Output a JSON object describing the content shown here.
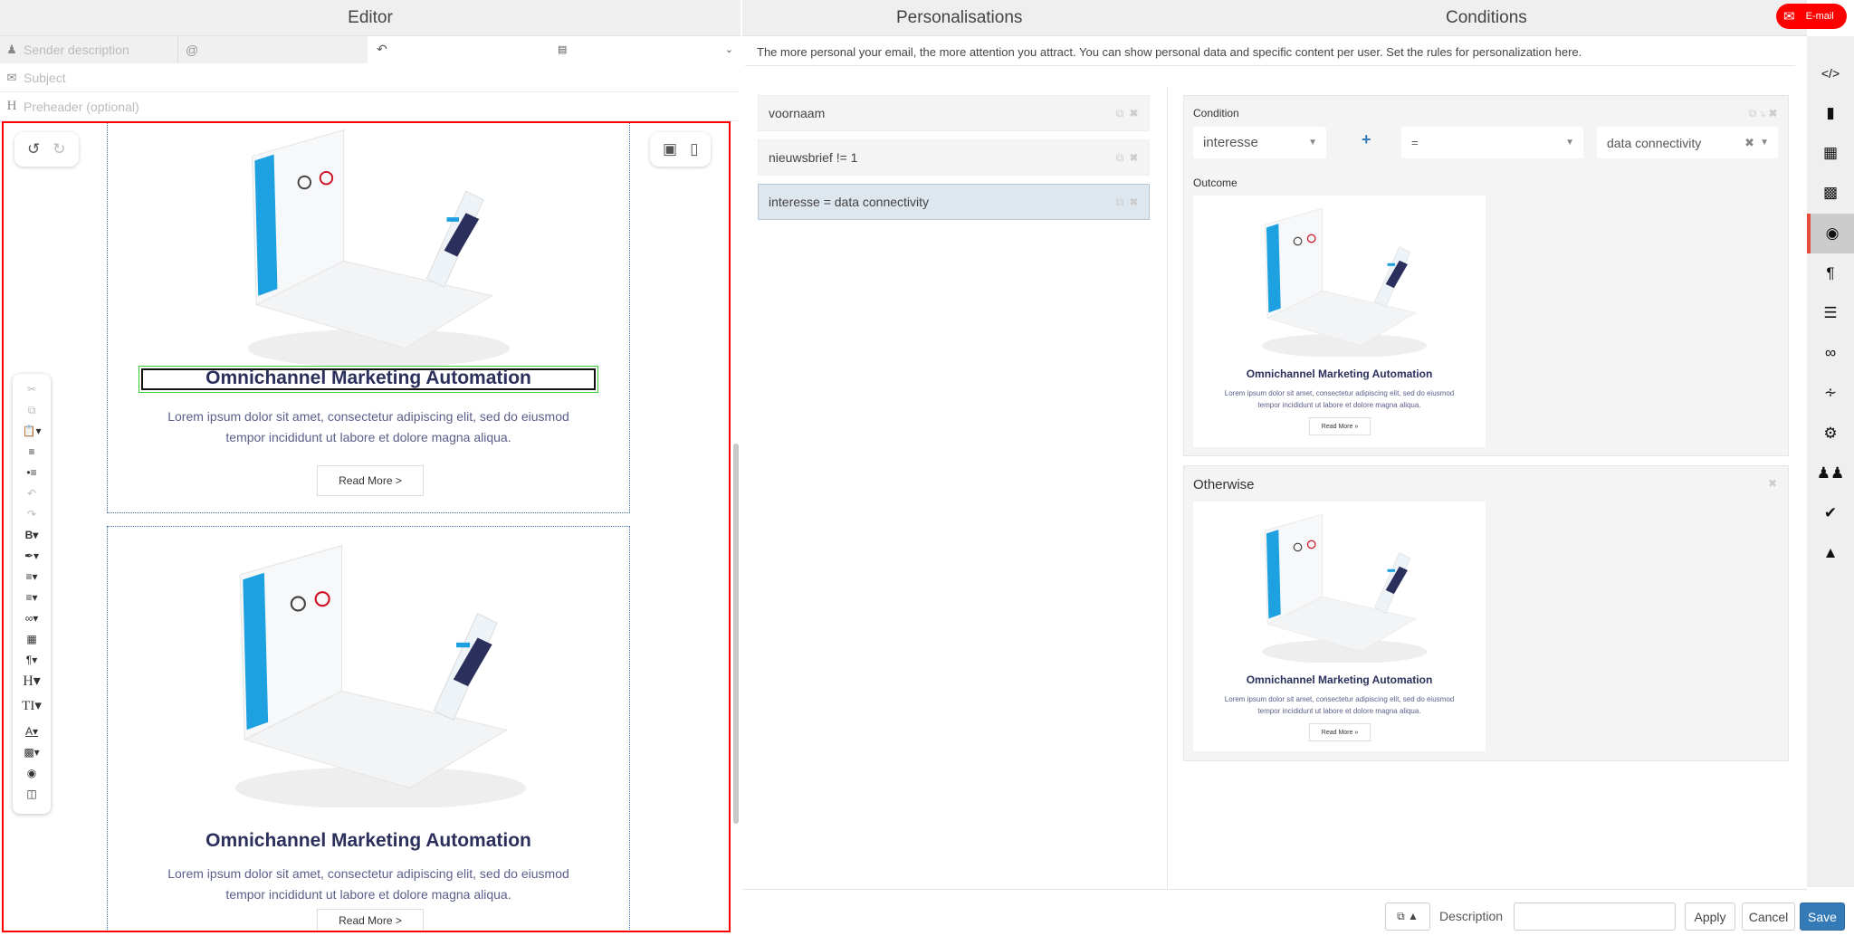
{
  "editor": {
    "title": "Editor",
    "sender_placeholder": "Sender description",
    "at_symbol": "@",
    "subject_placeholder": "Subject",
    "preheader_placeholder": "Preheader (optional)",
    "blocks": [
      {
        "heading": "Omnichannel Marketing Automation",
        "lorem1": "Lorem ipsum dolor sit amet, consectetur adipiscing elit, sed do eiusmod",
        "lorem2": "tempor incididunt ut labore et dolore magna aliqua.",
        "button": "Read More >"
      },
      {
        "heading": "Omnichannel Marketing Automation",
        "lorem1": "Lorem ipsum dolor sit amet, consectetur adipiscing elit, sed do eiusmod",
        "lorem2": "tempor incididunt ut labore et dolore magna aliqua.",
        "button": "Read More >"
      }
    ]
  },
  "personalisations": {
    "title": "Personalisations",
    "conditions_title": "Conditions",
    "badge": "E-mail",
    "description": "The more personal your email, the more attention you attract. You can show personal data and specific content per user. Set the rules for personalization here.",
    "items": [
      "voornaam",
      "nieuwsbrief != 1",
      "interesse = data connectivity"
    ]
  },
  "condition": {
    "label": "Condition",
    "field": "interesse",
    "operator": "=",
    "value": "data connectivity",
    "outcome_label": "Outcome",
    "otherwise_label": "Otherwise"
  },
  "thumb": {
    "heading": "Omnichannel Marketing Automation",
    "lorem1": "Lorem ipsum dolor sit amet, consectetur adipiscing elit, sed do eiusmod",
    "lorem2": "tempor incididunt ut labore et dolore magna aliqua.",
    "button": "Read More »"
  },
  "footer": {
    "description_label": "Description",
    "description_value": "",
    "apply": "Apply",
    "cancel": "Cancel",
    "save": "Save"
  },
  "colors": {
    "accent": "#337ab7",
    "badge": "#ff0000",
    "active_marker": "#e74c3c",
    "heading": "#2b2f5b"
  }
}
